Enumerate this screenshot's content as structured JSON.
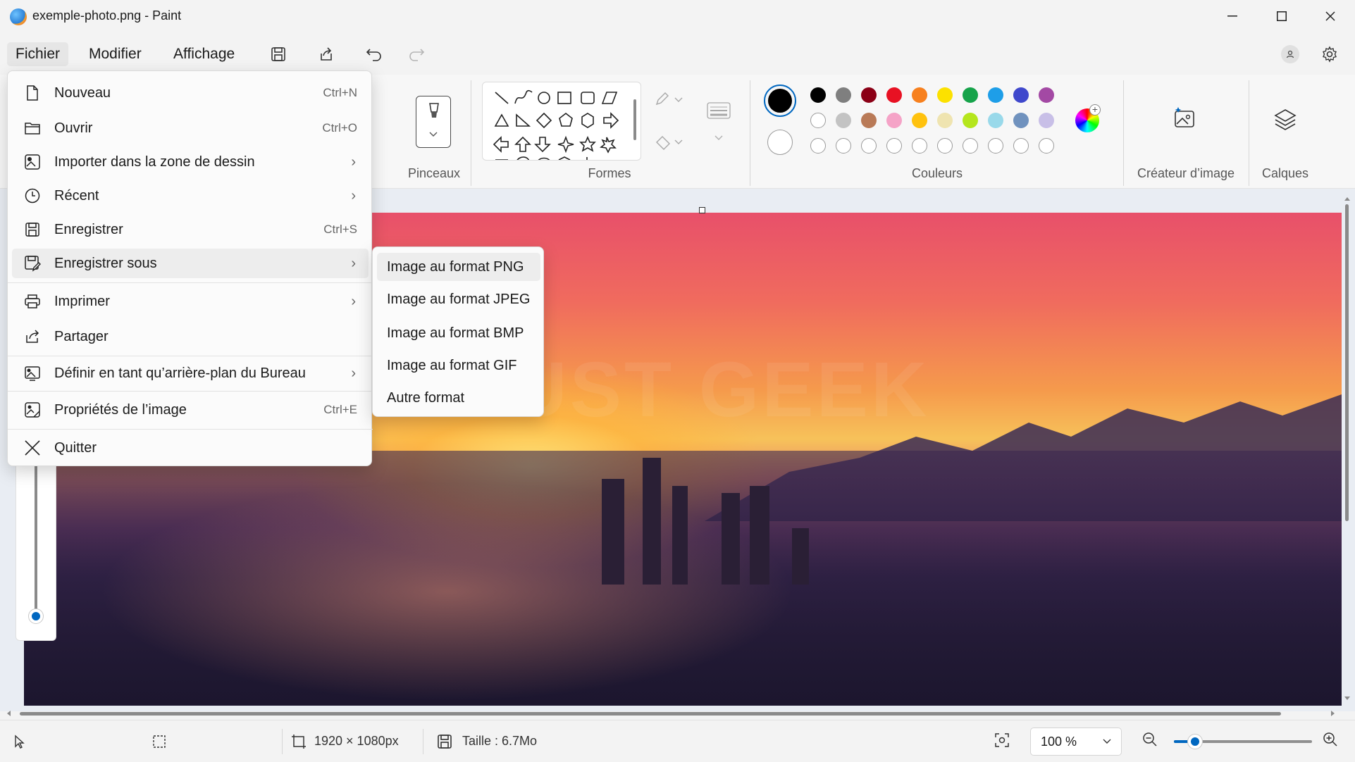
{
  "window": {
    "title": "exemple-photo.png - Paint"
  },
  "menubar": {
    "items": [
      "Fichier",
      "Modifier",
      "Affichage"
    ]
  },
  "ribbon": {
    "brushes_label": "Pinceaux",
    "shapes_label": "Formes",
    "colors_label": "Couleurs",
    "image_creator_label": "Créateur d’image",
    "layers_label": "Calques",
    "palette_row1": [
      "#000000",
      "#7f7f7f",
      "#8b0016",
      "#e81123",
      "#f7801e",
      "#fce100",
      "#16a34a",
      "#1e9ee8",
      "#3f48cc",
      "#a349a4"
    ],
    "palette_row2": [
      "#ffffff",
      "#c3c3c3",
      "#b97a57",
      "#f5a3c7",
      "#ffc20e",
      "#efe4b0",
      "#b5e61d",
      "#99d9ea",
      "#7092be",
      "#c8bfe7"
    ],
    "primary_color": "#000000",
    "secondary_color": "#ffffff"
  },
  "file_menu": {
    "items": [
      {
        "label": "Nouveau",
        "shortcut": "Ctrl+N",
        "icon": "new-file-icon"
      },
      {
        "label": "Ouvrir",
        "shortcut": "Ctrl+O",
        "icon": "folder-icon"
      },
      {
        "label": "Importer dans la zone de dessin",
        "shortcut": "",
        "icon": "import-image-icon"
      },
      {
        "label": "Récent",
        "shortcut": "",
        "icon": "clock-icon"
      },
      {
        "label": "Enregistrer",
        "shortcut": "Ctrl+S",
        "icon": "save-icon"
      },
      {
        "label": "Enregistrer sous",
        "shortcut": "",
        "icon": "save-as-icon"
      },
      {
        "label": "Imprimer",
        "shortcut": "",
        "icon": "printer-icon"
      },
      {
        "label": "Partager",
        "shortcut": "",
        "icon": "share-icon"
      },
      {
        "label": "Définir en tant qu’arrière-plan du Bureau",
        "shortcut": "",
        "icon": "wallpaper-icon"
      },
      {
        "label": "Propriétés de l’image",
        "shortcut": "Ctrl+E",
        "icon": "image-properties-icon"
      },
      {
        "label": "Quitter",
        "shortcut": "",
        "icon": "close-icon"
      }
    ]
  },
  "save_as_submenu": {
    "items": [
      "Image au format PNG",
      "Image au format JPEG",
      "Image au format BMP",
      "Image au format GIF",
      "Autre format"
    ]
  },
  "canvas": {
    "watermark": "JUST GEEK"
  },
  "statusbar": {
    "dimensions": "1920 × 1080px",
    "size": "Taille : 6.7Mo",
    "zoom": "100 %"
  }
}
